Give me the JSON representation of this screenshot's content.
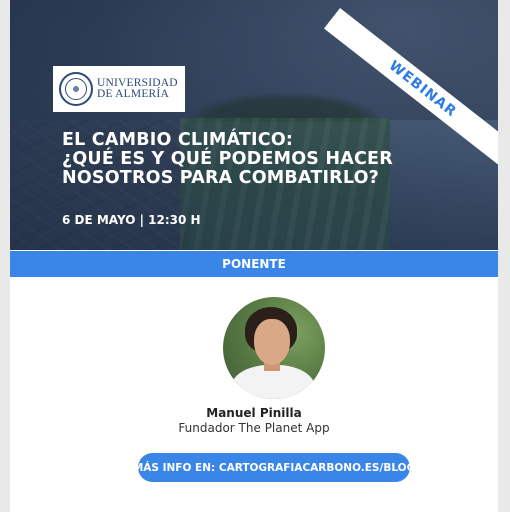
{
  "logo": {
    "line1": "UNIVERSIDAD",
    "line2": "DE ALMERÍA"
  },
  "badge": "WEBINAR",
  "title": {
    "line1": "EL CAMBIO CLIMÁTICO:",
    "line2": "¿QUÉ ES Y QUÉ PODEMOS HACER",
    "line3": "NOSOTROS PARA COMBATIRLO?"
  },
  "date_time": "6 DE MAYO |  12:30 H",
  "section_label": "PONENTE",
  "speaker": {
    "name": "Manuel Pinilla",
    "role": "Fundador The Planet App"
  },
  "cta": "MÁS INFO EN: CARTOGRAFIACARBONO.ES/BLOG",
  "colors": {
    "accent": "#3a86e8",
    "hero_dark": "#2e3d55",
    "logo_blue": "#2c4a7a"
  }
}
